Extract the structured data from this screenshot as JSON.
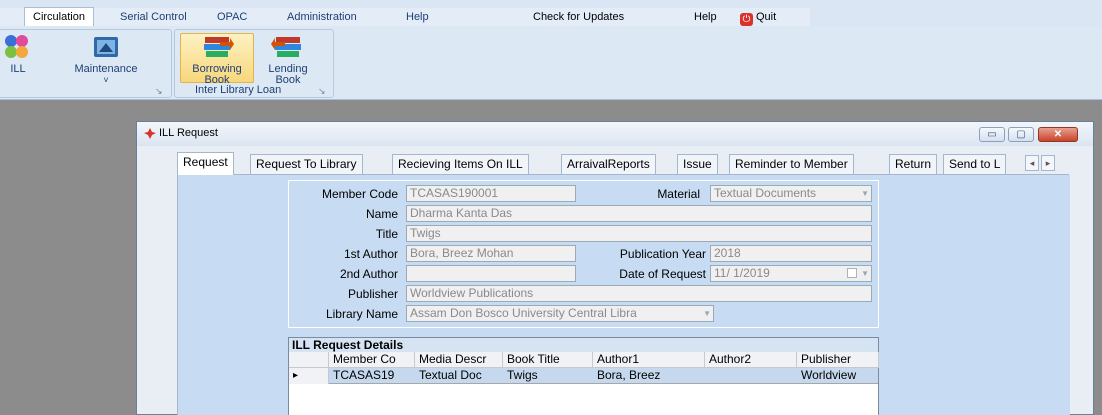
{
  "menu": {
    "tabs": [
      "Circulation",
      "Serial Control",
      "OPAC",
      "Administration",
      "Help"
    ],
    "active_tab": "Circulation",
    "check_updates": "Check for Updates",
    "help": "Help",
    "quit": "Quit"
  },
  "ribbon": {
    "ill_label": "ILL",
    "maintenance_label": "Maintenance",
    "maintenance_arrow": "˅",
    "borrowing_label_1": "Borrowing",
    "borrowing_label_2": "Book",
    "lending_label_1": "Lending",
    "lending_label_2": "Book",
    "group_label": "Inter Library Loan"
  },
  "window": {
    "title": "ILL Request",
    "tabs": [
      "Request",
      "Request To Library",
      "Recieving Items On ILL",
      "ArraivalReports",
      "Issue",
      "Reminder to Member",
      "Return",
      "Send  to L"
    ],
    "active_tab": "Request"
  },
  "form": {
    "member_code_label": "Member Code",
    "member_code": "TCASAS190001",
    "material_label": "Material",
    "material": "Textual Documents",
    "name_label": "Name",
    "name": "Dharma Kanta Das",
    "title_label": "Title",
    "title": "Twigs",
    "author1_label": "1st Author",
    "author1": "Bora, Breez Mohan",
    "pub_year_label": "Publication Year",
    "pub_year": "2018",
    "author2_label": "2nd Author",
    "author2": "",
    "date_label": "Date of Request",
    "date": "11/  1/2019",
    "publisher_label": "Publisher",
    "publisher": "Worldview Publications",
    "library_label": "Library Name",
    "library": "Assam Don Bosco University Central Libra"
  },
  "grid": {
    "caption": "ILL Request Details",
    "columns": [
      "Member Co",
      "Media Descr",
      "Book Title",
      "Author1",
      "Author2",
      "Publisher"
    ],
    "row": {
      "marker": "▸",
      "cells": [
        "TCASAS19",
        "Textual Doc",
        "Twigs",
        "Bora, Breez",
        "",
        "Worldview"
      ]
    }
  },
  "colors": {
    "panel": "#c7dcf2",
    "selected_row": "#c6d8ee",
    "accent": "#1e3f73"
  }
}
